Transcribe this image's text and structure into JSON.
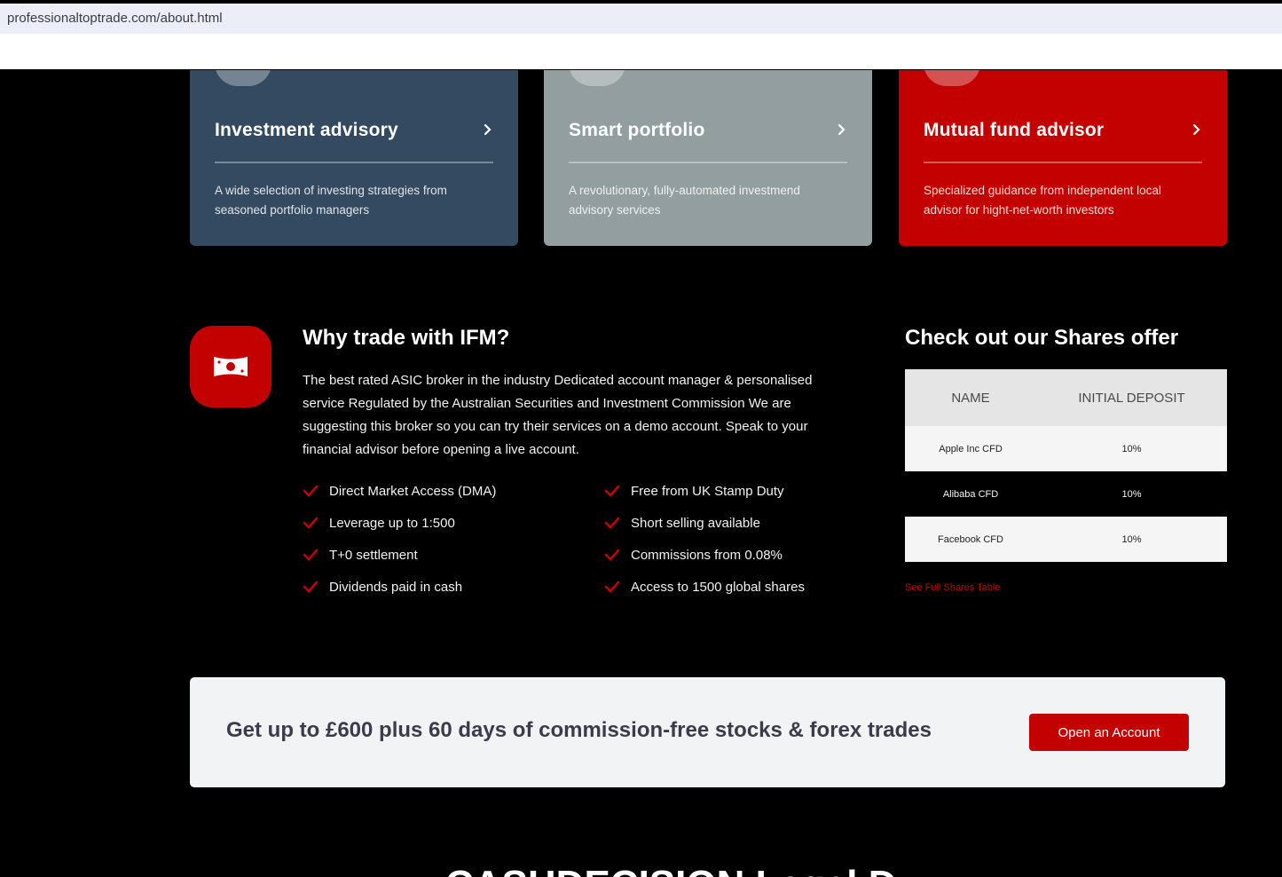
{
  "browser": {
    "url": "professionaltoptrade.com/about.html"
  },
  "services": [
    {
      "title": "Investment advisory",
      "description": "A wide selection of investing strategies from seasoned portfolio managers"
    },
    {
      "title": "Smart portfolio",
      "description": "A revolutionary, fully-automated investmend advisory services"
    },
    {
      "title": "Mutual fund advisor",
      "description": "Specialized guidance from independent local advisor for hight-net-worth investors"
    }
  ],
  "why": {
    "title": "Why trade with IFM?",
    "text": "The best rated ASIC broker in the industry Dedicated account manager & personalised service Regulated by the Australian Securities and Investment Commission We are suggesting this broker so you can try their services on a demo account. Speak to your financial advisor before opening a live account.",
    "features": [
      "Direct Market Access (DMA)",
      "Free from UK Stamp Duty",
      "Leverage up to 1:500",
      "Short selling available",
      "T+0 settlement",
      "Commissions from 0.08%",
      "Dividends paid in cash",
      "Access to 1500 global shares"
    ]
  },
  "shares": {
    "title": "Check out our Shares offer",
    "headers": [
      "Name",
      "Initial Deposit"
    ],
    "rows": [
      {
        "name": "Apple Inc CFD",
        "deposit": "10%"
      },
      {
        "name": "Alibaba CFD",
        "deposit": "10%"
      },
      {
        "name": "Facebook CFD",
        "deposit": "10%"
      }
    ],
    "link": "See Full Shares Table"
  },
  "promo": {
    "text": "Get up to £600 plus 60 days of commission-free stocks & forex trades",
    "button": "Open an Account"
  },
  "bottom_heading": "CASHDECISION Legal D",
  "colors": {
    "accent": "#c30101",
    "card_navy": "#344a61",
    "card_gray": "#929ea0",
    "background": "#000000"
  },
  "icons": {
    "badge": "money-bill-icon",
    "feature": "check-icon",
    "card": "chevron-right-icon"
  }
}
